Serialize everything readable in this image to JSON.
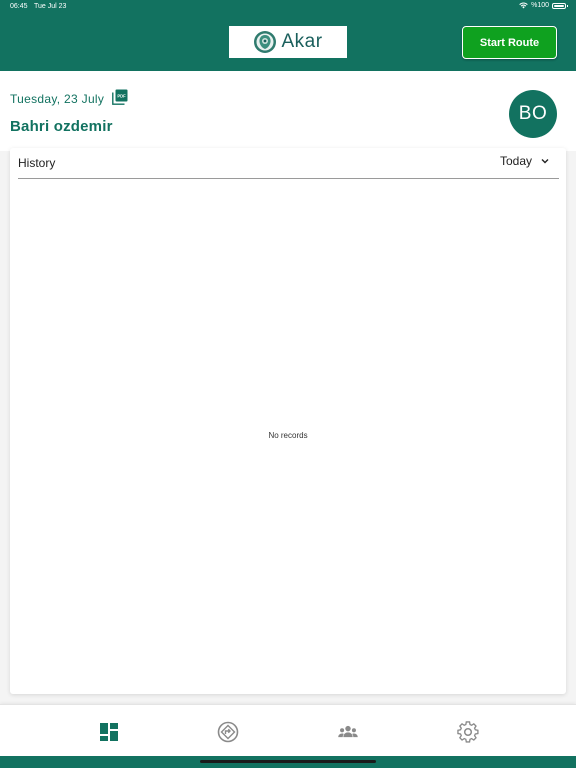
{
  "status_bar": {
    "time": "06:45",
    "date": "Tue Jul 23",
    "battery": "%100"
  },
  "header": {
    "logo_text": "Akar",
    "start_route_label": "Start Route"
  },
  "info": {
    "date": "Tuesday, 23 July",
    "driver_name": "Bahri ozdemir",
    "avatar_initials": "BO"
  },
  "history": {
    "title": "History",
    "period": "Today",
    "empty_message": "No records"
  },
  "bottom_nav": {
    "items": [
      {
        "icon": "dashboard-icon",
        "active": true
      },
      {
        "icon": "routes-icon",
        "active": false
      },
      {
        "icon": "customers-icon",
        "active": false
      },
      {
        "icon": "settings-icon",
        "active": false
      }
    ]
  },
  "colors": {
    "primary": "#127260",
    "start_button": "#0fa11f",
    "inactive_icon": "#8a8a8a"
  }
}
